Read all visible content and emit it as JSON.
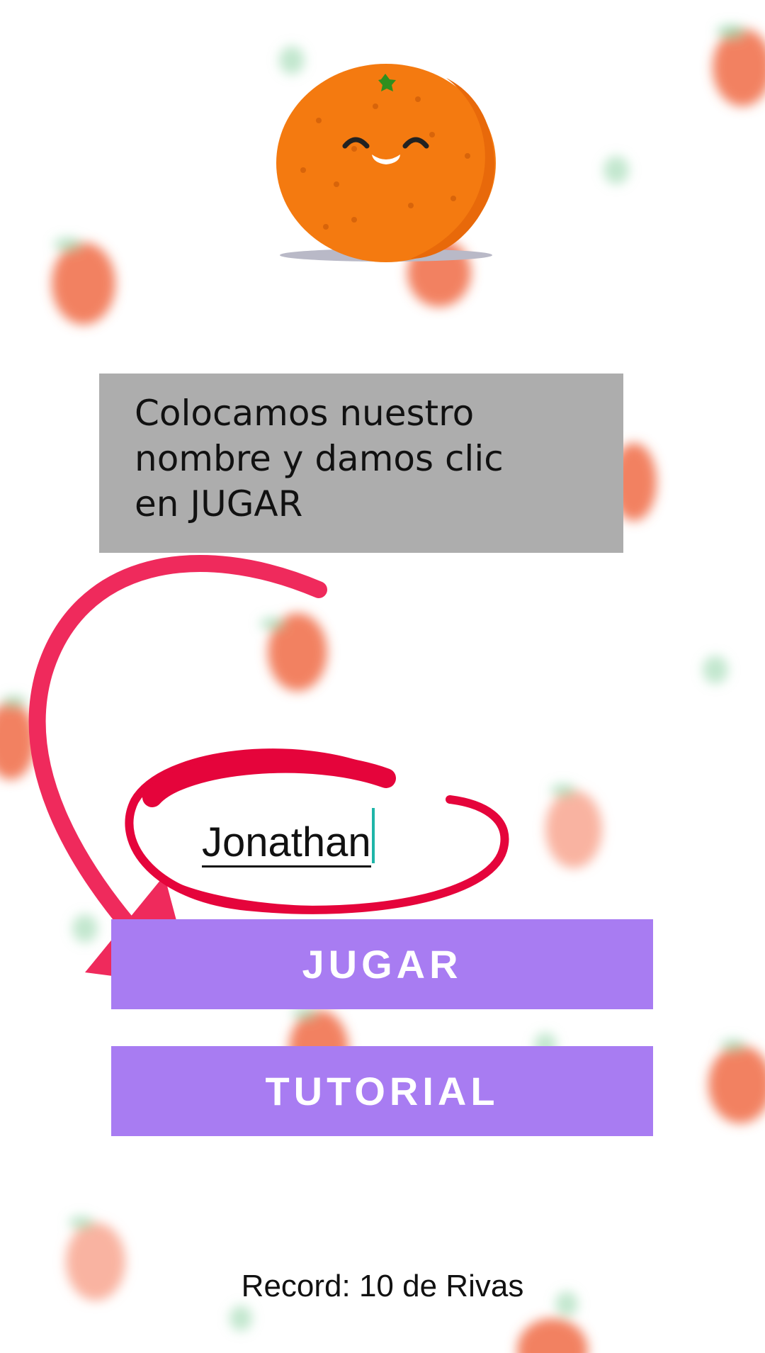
{
  "tutorial_note": {
    "text": "Colocamos nuestro\nnombre y damos clic\nen JUGAR"
  },
  "name_input": {
    "value": "Jonathan"
  },
  "buttons": {
    "play_label": "JUGAR",
    "tutorial_label": "TUTORIAL"
  },
  "record": {
    "text": "Record: 10 de Rivas"
  },
  "colors": {
    "button_bg": "#a87cf2",
    "note_bg": "#adadad",
    "annotation_red": "#e8224d",
    "orange": "#f47a10"
  },
  "icons": {
    "mascot": "smiling-orange-icon",
    "background": "strawberry-icon"
  }
}
